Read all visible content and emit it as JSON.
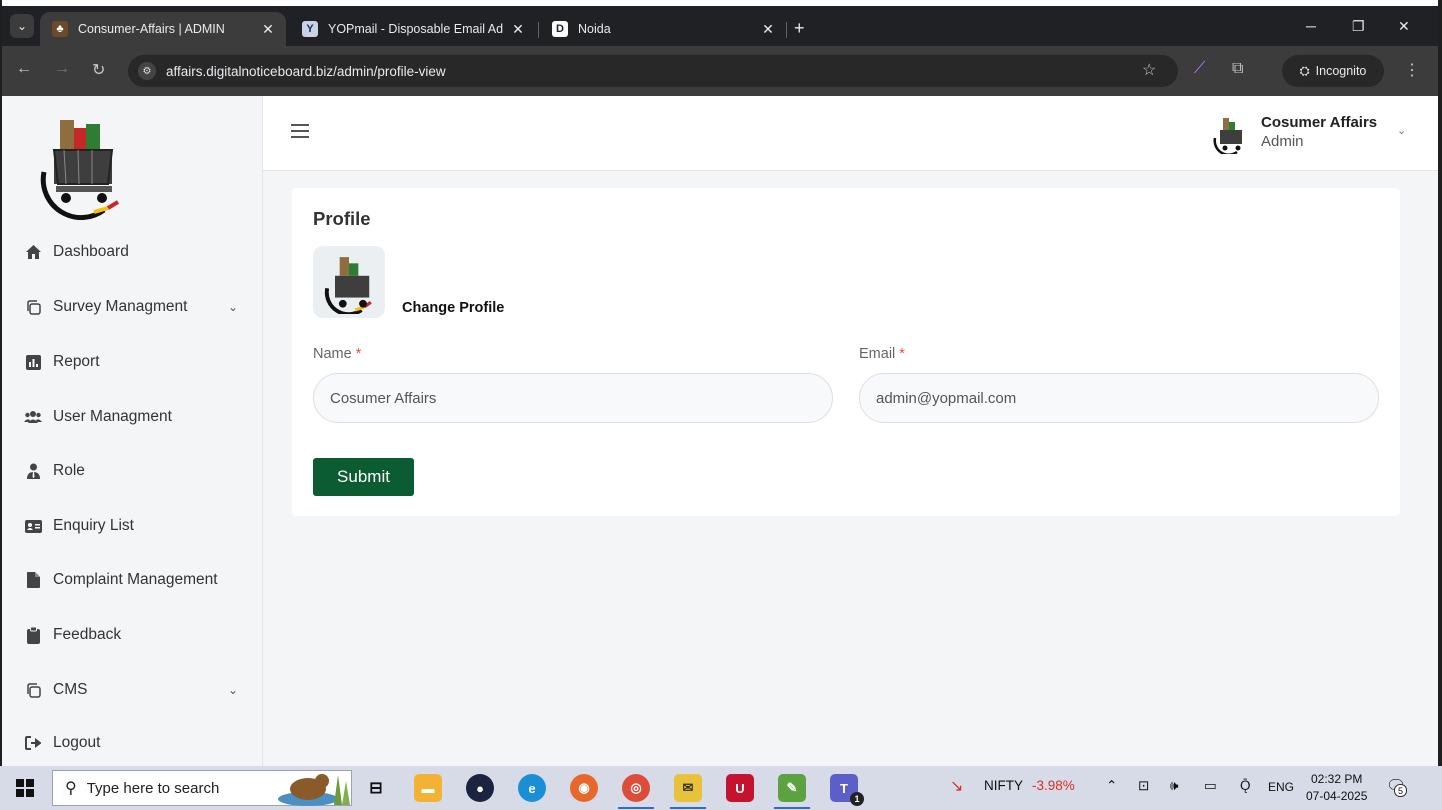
{
  "browser": {
    "tabs": [
      {
        "title": "Consumer-Affairs | ADMIN",
        "active": true
      },
      {
        "title": "YOPmail - Disposable Email Ad",
        "active": false
      },
      {
        "title": "Noida",
        "active": false
      }
    ],
    "new_tab_label": "+",
    "url": "affairs.digitalnoticeboard.biz/admin/profile-view",
    "incognito_label": "Incognito"
  },
  "sidebar": {
    "items": [
      {
        "label": "Dashboard",
        "icon": "home-icon",
        "has_chevron": false
      },
      {
        "label": "Survey Managment",
        "icon": "copy-icon",
        "has_chevron": true
      },
      {
        "label": "Report",
        "icon": "bar-chart-icon",
        "has_chevron": false
      },
      {
        "label": "User Managment",
        "icon": "users-icon",
        "has_chevron": false
      },
      {
        "label": "Role",
        "icon": "user-tie-icon",
        "has_chevron": false
      },
      {
        "label": "Enquiry List",
        "icon": "id-card-icon",
        "has_chevron": false
      },
      {
        "label": "Complaint Management",
        "icon": "file-icon",
        "has_chevron": false
      },
      {
        "label": "Feedback",
        "icon": "clipboard-icon",
        "has_chevron": false
      },
      {
        "label": "CMS",
        "icon": "copy-icon",
        "has_chevron": true
      },
      {
        "label": "Logout",
        "icon": "logout-icon",
        "has_chevron": false
      }
    ]
  },
  "header": {
    "user_name": "Cosumer Affairs",
    "user_role": "Admin"
  },
  "profile": {
    "title": "Profile",
    "change_profile_label": "Change Profile",
    "name_label": "Name",
    "email_label": "Email",
    "required_mark": "*",
    "name_value": "Cosumer Affairs",
    "email_value": "admin@yopmail.com",
    "submit_label": "Submit"
  },
  "taskbar": {
    "search_placeholder": "Type here to search",
    "nifty_label": "NIFTY",
    "nifty_change": "-3.98%",
    "language": "ENG",
    "time": "02:32 PM",
    "date": "07-04-2025",
    "teams_badge": "1",
    "notification_count": "5"
  },
  "colors": {
    "accent_green": "#0b5c33",
    "required_red": "#e05252",
    "nifty_red": "#d93025"
  }
}
